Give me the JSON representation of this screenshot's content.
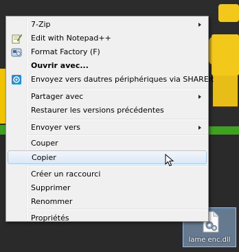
{
  "context_menu": {
    "items": [
      {
        "label": "7-Zip",
        "submenu": true
      },
      {
        "label": "Edit with Notepad++",
        "icon": "notepad-plus-icon"
      },
      {
        "label": "Format Factory (F)",
        "icon": "format-factory-icon"
      },
      {
        "label": "Ouvrir avec...",
        "bold": true
      },
      {
        "label": "Envoyez vers dautres périphériques via SHAREit",
        "icon": "shareit-icon"
      },
      {
        "label": "Partager avec",
        "submenu": true
      },
      {
        "label": "Restaurer les versions précédentes"
      },
      {
        "label": "Envoyer vers",
        "submenu": true
      },
      {
        "label": "Couper"
      },
      {
        "label": "Copier",
        "hovered": true
      },
      {
        "label": "Créer un raccourci"
      },
      {
        "label": "Supprimer"
      },
      {
        "label": "Renommer"
      },
      {
        "label": "Propriétés"
      }
    ]
  },
  "desktop_file": {
    "label": "lame enc.dll",
    "icon": "dll-file-icon"
  },
  "colors": {
    "menu_background": "#f0f0f0",
    "hover_border": "#a8c8ea",
    "selection_fill": "#96b9e1"
  }
}
